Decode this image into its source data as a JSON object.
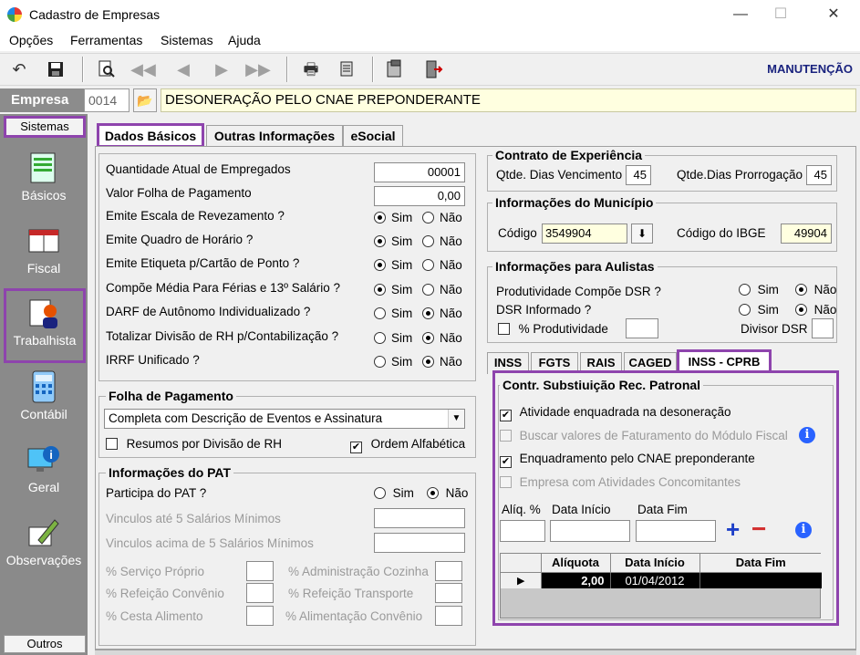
{
  "window": {
    "title": "Cadastro de Empresas",
    "minimize": "—",
    "maximize": "☐",
    "close": "✕"
  },
  "menu": [
    "Opções",
    "Ferramentas",
    "Sistemas",
    "Ajuda"
  ],
  "toolbar": {
    "mode_label": "MANUTENÇÃO",
    "icons": [
      "undo-icon",
      "save-icon",
      "preview-icon",
      "first-icon",
      "prev-icon",
      "next-icon",
      "last-icon",
      "print-icon",
      "report-icon",
      "stamp-icon",
      "exit-icon"
    ]
  },
  "empresa": {
    "label": "Empresa",
    "code": "0014",
    "name": "DESONERAÇÃO PELO CNAE PREPONDERANTE"
  },
  "sidebar": {
    "header": "Sistemas",
    "items": [
      {
        "label": "Básicos"
      },
      {
        "label": "Fiscal"
      },
      {
        "label": "Trabalhista"
      },
      {
        "label": "Contábil"
      },
      {
        "label": "Geral"
      },
      {
        "label": "Observações"
      }
    ],
    "footer": "Outros"
  },
  "tabs": [
    "Dados Básicos",
    "Outras Informações",
    "eSocial"
  ],
  "dados": {
    "qtd_empregados_label": "Quantidade Atual de Empregados",
    "qtd_empregados": "00001",
    "valor_folha_label": "Valor Folha de Pagamento",
    "valor_folha": "0,00",
    "sim": "Sim",
    "nao": "Não",
    "questions": [
      {
        "label": "Emite Escala de Revezamento ?",
        "value": "Sim"
      },
      {
        "label": "Emite Quadro de Horário ?",
        "value": "Sim"
      },
      {
        "label": "Emite Etiqueta p/Cartão de Ponto ?",
        "value": "Sim"
      },
      {
        "label": "Compõe Média Para Férias e 13º Salário ?",
        "value": "Sim"
      },
      {
        "label": "DARF de Autônomo Individualizado ?",
        "value": "Não"
      },
      {
        "label": "Totalizar Divisão de RH p/Contabilização ?",
        "value": "Não"
      },
      {
        "label": "IRRF Unificado ?",
        "value": "Não"
      }
    ]
  },
  "folha": {
    "title": "Folha de Pagamento",
    "selected": "Completa com Descrição de Eventos e Assinatura",
    "resumos_label": "Resumos por Divisão de RH",
    "ordem_label": "Ordem Alfabética"
  },
  "pat": {
    "title": "Informações do PAT",
    "participa_label": "Participa do PAT ?",
    "participa_value": "Não",
    "vinc_ate_label": "Vinculos até 5 Salários Mínimos",
    "vinc_acima_label": "Vinculos acima de 5 Salários Mínimos",
    "servico_proprio": "% Serviço Próprio",
    "adm_cozinha": "% Administração Cozinha",
    "ref_convenio": "% Refeição Convênio",
    "ref_transporte": "% Refeição Transporte",
    "cesta": "% Cesta Alimento",
    "alim_convenio": "% Alimentação Convênio"
  },
  "contrato": {
    "title": "Contrato de Experiência",
    "venc_label": "Qtde. Dias Vencimento",
    "venc": "45",
    "prorrog_label": "Qtde.Dias Prorrogação",
    "prorrog": "45"
  },
  "municipio": {
    "title": "Informações do Município",
    "codigo_label": "Código",
    "codigo": "3549904",
    "ibge_label": "Código do IBGE",
    "ibge": "49904"
  },
  "aulistas": {
    "title": "Informações para Aulistas",
    "produtividade_label": "Produtividade Compõe DSR ?",
    "produtividade_value": "Não",
    "dsr_label": "DSR Informado ?",
    "dsr_value": "Não",
    "pct_prod_label": "% Produtividade",
    "divisor_label": "Divisor DSR"
  },
  "subtabs": [
    "INSS",
    "FGTS",
    "RAIS",
    "CAGED",
    "INSS - CPRB"
  ],
  "cprb": {
    "title": "Contr. Substiuição Rec. Patronal",
    "opt1": "Atividade enquadrada na desoneração",
    "opt2": "Buscar valores de Faturamento do Módulo Fiscal",
    "opt3": "Enquadramento pelo CNAE preponderante",
    "opt4": "Empresa com Atividades Concomitantes",
    "aliq_label": "Alíq. %",
    "data_inicio_label": "Data Início",
    "data_fim_label": "Data Fim",
    "grid_headers": [
      "Alíquota",
      "Data Início",
      "Data Fim"
    ],
    "grid_rows": [
      {
        "aliquota": "2,00",
        "data_inicio": "01/04/2012",
        "data_fim": ""
      }
    ]
  }
}
